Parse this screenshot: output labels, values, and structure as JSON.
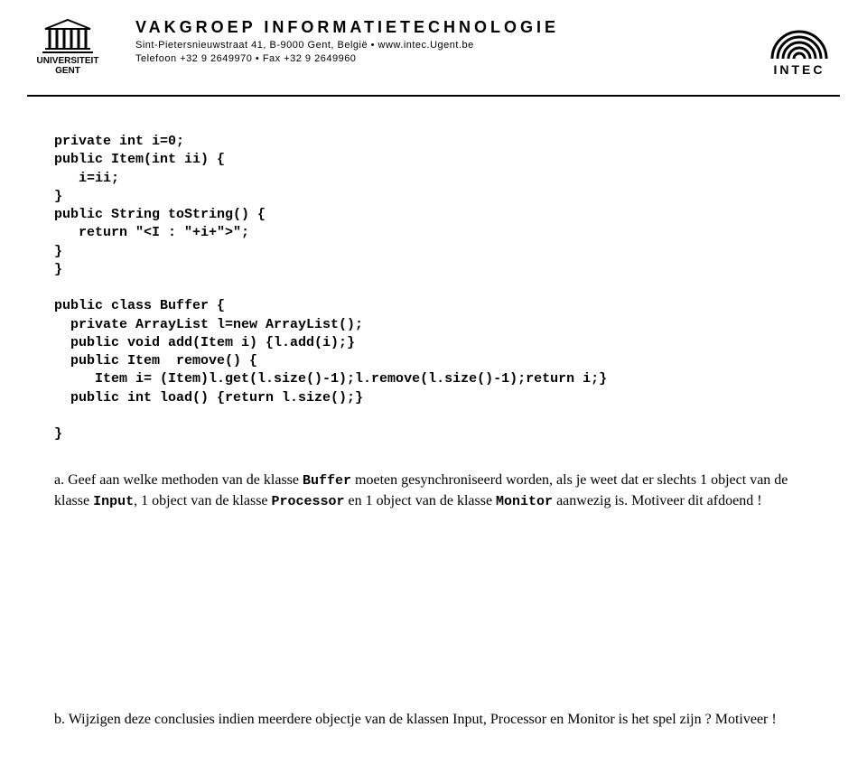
{
  "header": {
    "uni_line1": "UNIVERSITEIT",
    "uni_line2": "GENT",
    "title": "VAKGROEP INFORMATIETECHNOLOGIE",
    "addr": "Sint-Pietersnieuwstraat 41, B-9000 Gent, België • www.intec.Ugent.be",
    "tel": "Telefoon +32 9 2649970 • Fax +32 9 2649960",
    "intec": "INTEC"
  },
  "code": "private int i=0;\npublic Item(int ii) {\n   i=ii;\n}\npublic String toString() {\n   return \"<I : \"+i+\">\";\n}\n}\n\npublic class Buffer {\n  private ArrayList l=new ArrayList();\n  public void add(Item i) {l.add(i);}\n  public Item  remove() {\n     Item i= (Item)l.get(l.size()-1);l.remove(l.size()-1);return i;}\n  public int load() {return l.size();}\n\n}",
  "qa": {
    "prefix": "a. Geef aan welke methoden van de klasse ",
    "buffer": "Buffer",
    "mid1": " moeten gesynchroniseerd worden, als je weet dat er slechts 1 object van de klasse ",
    "input": "Input",
    "mid2": ", 1 object van de klasse ",
    "processor": "Processor",
    "mid3": " en 1 object van de klasse ",
    "monitor": "Monitor",
    "tail": " aanwezig is. Motiveer dit afdoend !"
  },
  "qb": "b. Wijzigen deze conclusies indien meerdere objectje van de klassen Input, Processor en Monitor is het spel zijn ? Motiveer !"
}
